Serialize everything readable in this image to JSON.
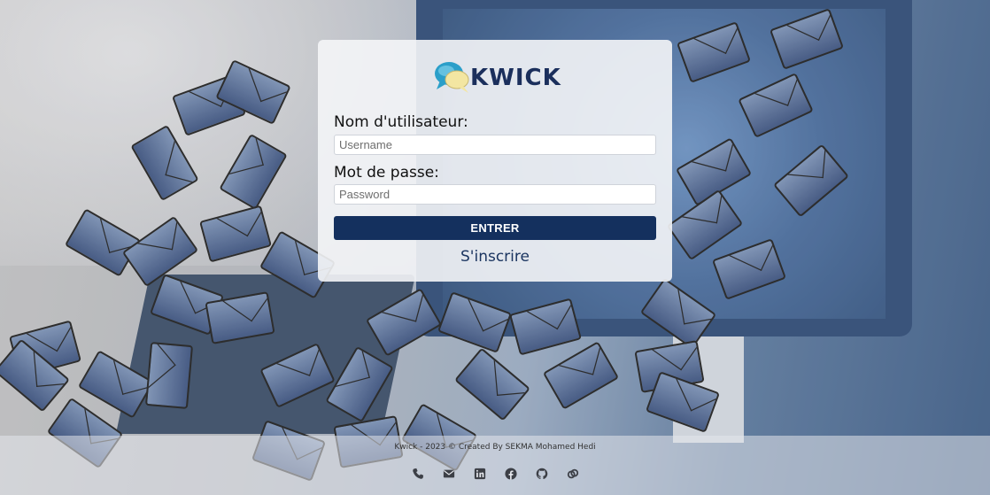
{
  "brand": {
    "name": "KWICK",
    "logo_icon": "chat-bubbles-icon",
    "colors": {
      "primary": "#14305e",
      "bubble_blue": "#2b9fc9",
      "bubble_yellow": "#f3e6a2"
    }
  },
  "login": {
    "username_label": "Nom d'utilisateur:",
    "username_placeholder": "Username",
    "username_value": "",
    "password_label": "Mot de passe:",
    "password_placeholder": "Password",
    "password_value": "",
    "submit_label": "ENTRER",
    "signup_link": "S'inscrire"
  },
  "footer": {
    "text": "Kwick - 2023 © Created By SEKMA Mohamed Hedi",
    "icons": [
      "phone-icon",
      "envelope-icon",
      "linkedin-icon",
      "facebook-icon",
      "github-icon",
      "link-icon"
    ]
  }
}
